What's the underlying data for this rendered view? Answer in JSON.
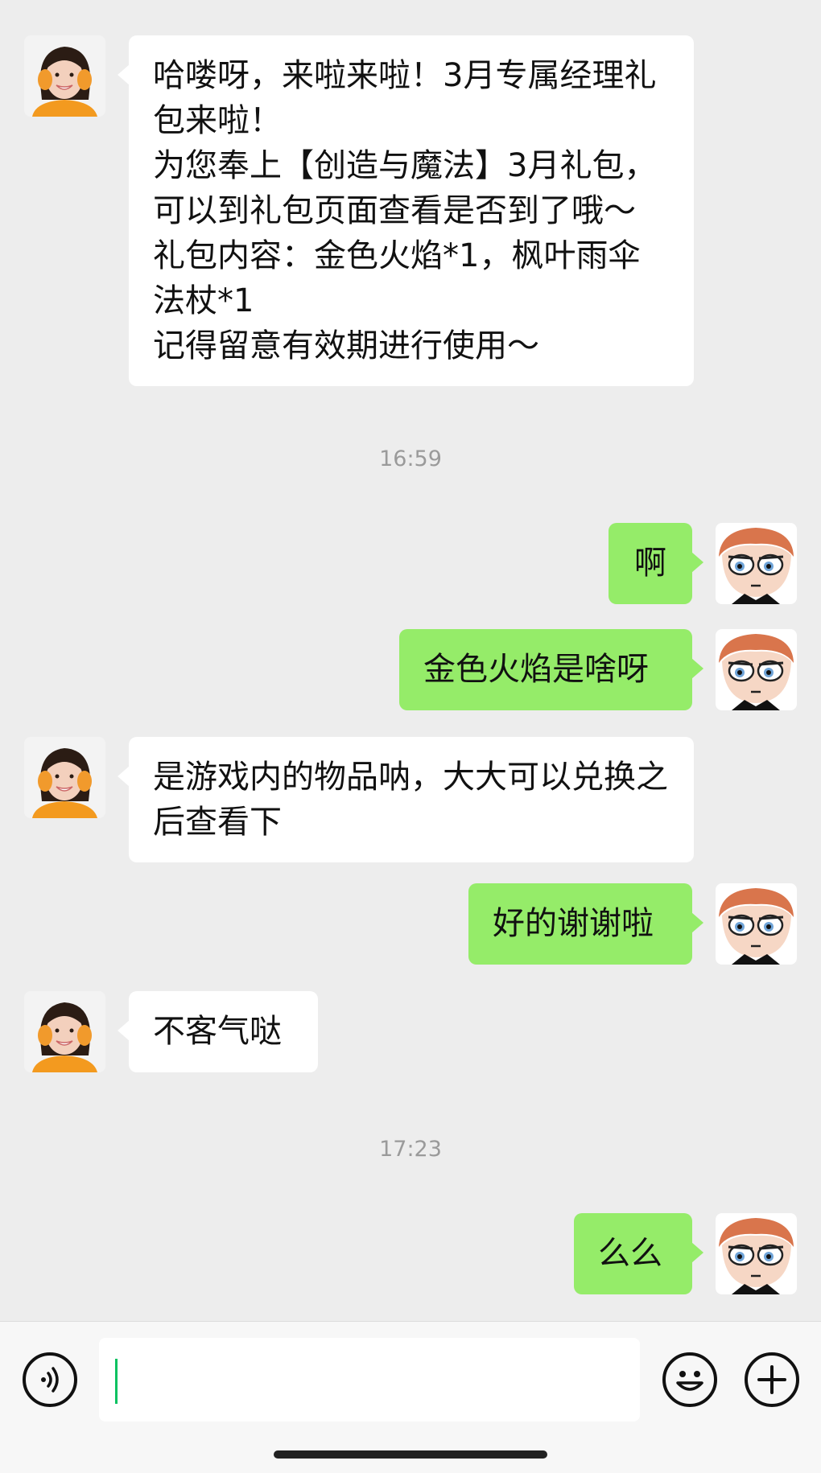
{
  "messages": [
    {
      "side": "left",
      "text": "哈喽呀，来啦来啦！3月专属经理礼包来啦！\n为您奉上【创造与魔法】3月礼包，可以到礼包页面查看是否到了哦～\n礼包内容：金色火焰*1，枫叶雨伞法杖*1\n记得留意有效期进行使用～"
    },
    {
      "time": "16:59"
    },
    {
      "side": "right",
      "text": "啊"
    },
    {
      "side": "right",
      "text": "金色火焰是啥呀"
    },
    {
      "side": "left",
      "text": "是游戏内的物品呐，大大可以兑换之后查看下"
    },
    {
      "side": "right",
      "text": "好的谢谢啦"
    },
    {
      "side": "left",
      "text": "不客气哒"
    },
    {
      "time": "17:23"
    },
    {
      "side": "right",
      "text": "么么"
    }
  ],
  "input_bar": {
    "left_icon": "voice-icon",
    "right_icons": [
      "emoji-icon",
      "plus-icon"
    ],
    "text_value": ""
  },
  "colors": {
    "background": "#ededed",
    "sent_bubble": "#95ec69",
    "received_bubble": "#ffffff",
    "time_text": "#9a9a9a",
    "caret": "#07c160"
  }
}
